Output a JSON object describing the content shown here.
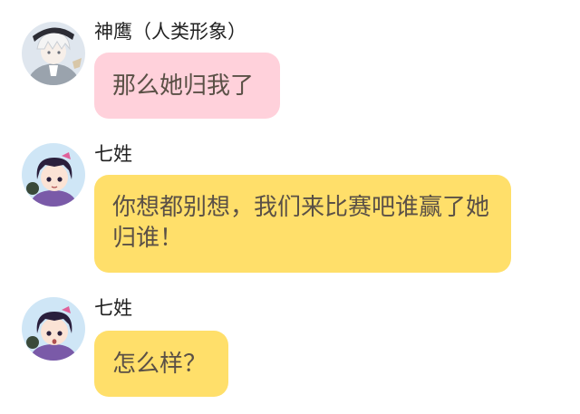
{
  "messages": [
    {
      "sender": "神鹰（人类形象）",
      "text": "那么她归我了",
      "bubble_color": "#ffd1db",
      "avatar": "white-haired-character-avatar"
    },
    {
      "sender": "七姓",
      "text": "你想都别想，我们来比赛吧谁赢了她归谁！",
      "bubble_color": "#ffdf6a",
      "avatar": "purple-haired-girl-avatar"
    },
    {
      "sender": "七姓",
      "text": "怎么样？",
      "bubble_color": "#ffdf6a",
      "avatar": "purple-haired-girl-avatar"
    }
  ]
}
